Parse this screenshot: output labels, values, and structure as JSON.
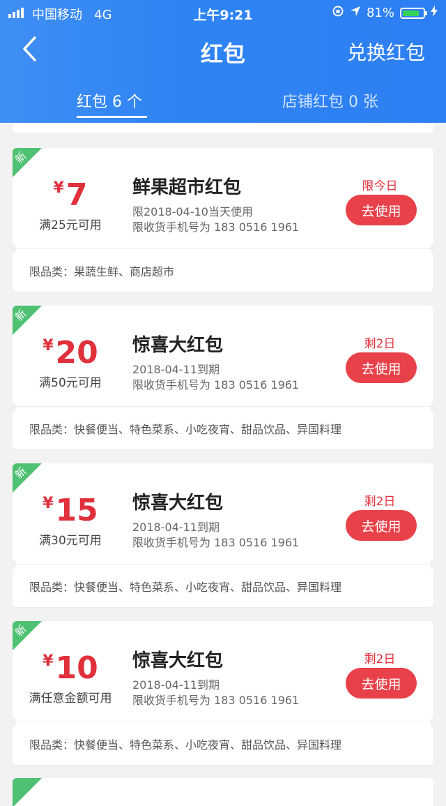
{
  "status_bar": {
    "carrier": "中国移动",
    "network": "4G",
    "time": "上午9:21",
    "battery": "81%",
    "battery_level": 0.81
  },
  "nav": {
    "title": "红包",
    "exchange_label": "兑换红包"
  },
  "tabs": [
    {
      "label": "红包 6 个",
      "active": true
    },
    {
      "label": "店铺红包 0 张",
      "active": false
    }
  ],
  "cards": [
    {
      "badge": "新",
      "currency": "¥",
      "amount": "7",
      "condition": "满25元可用",
      "title": "鲜果超市红包",
      "line1": "限2018-04-10当天使用",
      "line2": "限收货手机号为 183 0516 1961",
      "remain": "限今日",
      "button": "去使用",
      "category": "限品类：果蔬生鲜、商店超市"
    },
    {
      "badge": "新",
      "currency": "¥",
      "amount": "20",
      "condition": "满50元可用",
      "title": "惊喜大红包",
      "line1": "2018-04-11到期",
      "line2": "限收货手机号为 183 0516 1961",
      "remain": "剩2日",
      "button": "去使用",
      "category": "限品类：快餐便当、特色菜系、小吃夜宵、甜品饮品、异国料理"
    },
    {
      "badge": "新",
      "currency": "¥",
      "amount": "15",
      "condition": "满30元可用",
      "title": "惊喜大红包",
      "line1": "2018-04-11到期",
      "line2": "限收货手机号为 183 0516 1961",
      "remain": "剩2日",
      "button": "去使用",
      "category": "限品类：快餐便当、特色菜系、小吃夜宵、甜品饮品、异国料理"
    },
    {
      "badge": "新",
      "currency": "¥",
      "amount": "10",
      "condition": "满任意金额可用",
      "title": "惊喜大红包",
      "line1": "2018-04-11到期",
      "line2": "限收货手机号为 183 0516 1961",
      "remain": "剩2日",
      "button": "去使用",
      "category": "限品类：快餐便当、特色菜系、小吃夜宵、甜品饮品、异国料理"
    }
  ],
  "colors": {
    "header_blue": "#2f84f4",
    "accent_red": "#e0303c",
    "button_red": "#e8414a",
    "new_badge_green": "#4ec172"
  }
}
